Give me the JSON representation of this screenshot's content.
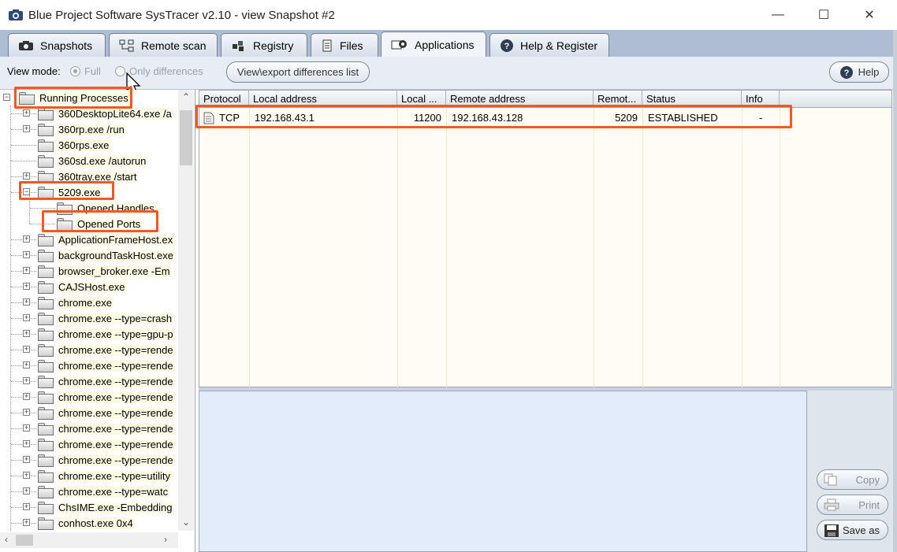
{
  "window": {
    "title": "Blue Project Software SysTracer v2.10 - view Snapshot #2",
    "minimize": "—",
    "maximize": "☐",
    "close": "✕"
  },
  "tabs": [
    {
      "label": "Snapshots",
      "icon": "camera-icon"
    },
    {
      "label": "Remote scan",
      "icon": "network-icon"
    },
    {
      "label": "Registry",
      "icon": "registry-icon"
    },
    {
      "label": "Files",
      "icon": "files-icon"
    },
    {
      "label": "Applications",
      "icon": "applications-icon",
      "active": true
    },
    {
      "label": "Help & Register",
      "icon": "help-icon"
    }
  ],
  "toolbar": {
    "view_mode_label": "View mode:",
    "full_label": "Full",
    "only_diff_label": "Only differences",
    "full_selected": true,
    "view_export_label": "View\\export differences list",
    "help_label": "Help"
  },
  "tree": {
    "root": "Running Processes",
    "items": [
      "360DesktopLite64.exe /a",
      "360rp.exe /run",
      "360rps.exe",
      "360sd.exe /autorun",
      "360tray.exe /start",
      "5209.exe",
      "Opened Handles",
      "Opened Ports",
      "ApplicationFrameHost.ex",
      "backgroundTaskHost.exe",
      "browser_broker.exe -Em",
      "CAJSHost.exe",
      "chrome.exe",
      "chrome.exe --type=crash",
      "chrome.exe --type=gpu-p",
      "chrome.exe --type=rende",
      "chrome.exe --type=rende",
      "chrome.exe --type=rende",
      "chrome.exe --type=rende",
      "chrome.exe --type=rende",
      "chrome.exe --type=rende",
      "chrome.exe --type=rende",
      "chrome.exe --type=rende",
      "chrome.exe --type=utility",
      "chrome.exe --type=watc",
      "ChsIME.exe -Embedding",
      "conhost.exe 0x4"
    ]
  },
  "grid": {
    "columns": [
      "Protocol",
      "Local address",
      "Local ...",
      "Remote address",
      "Remot...",
      "Status",
      "Info"
    ],
    "rows": [
      [
        "TCP",
        "192.168.43.1",
        "11200",
        "192.168.43.128",
        "5209",
        "ESTABLISHED",
        "-"
      ]
    ]
  },
  "side_buttons": {
    "copy": "Copy",
    "print": "Print",
    "save_as": "Save as"
  },
  "colors": {
    "highlight": "#f05a22",
    "tabstrip": "#aebdd1",
    "grid_bg": "#fffdf3",
    "detail_bg": "#e2ecfa"
  }
}
